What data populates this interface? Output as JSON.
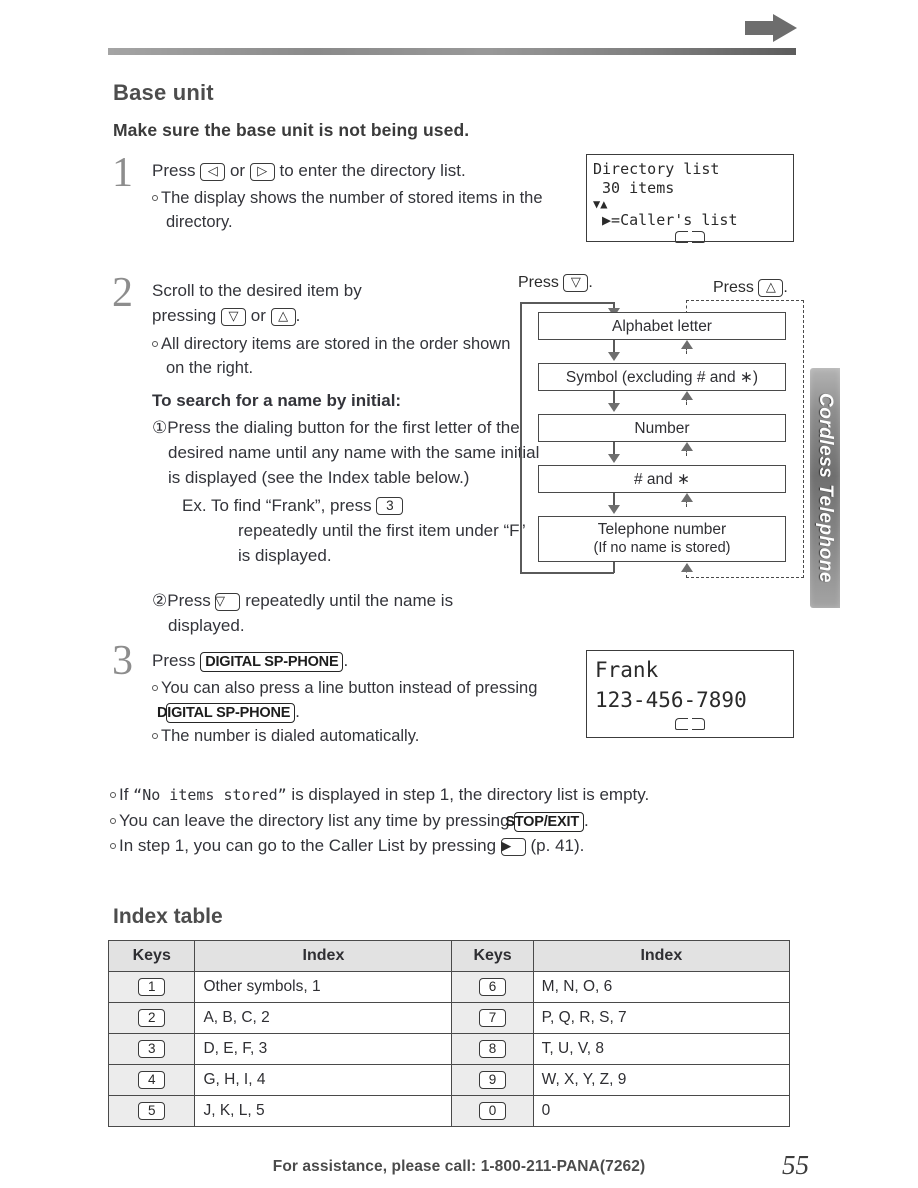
{
  "side_tab": {
    "label": "Cordless Telephone"
  },
  "headings": {
    "base_unit": "Base unit",
    "make_sure": "Make sure the base unit is not being used.",
    "index_table": "Index table"
  },
  "steps": {
    "one": {
      "number": "1",
      "line1_a": "Press",
      "key_left": "◁",
      "line1_b": "or",
      "key_right": "▷",
      "line1_c": "to enter the directory list.",
      "bullet1": "The display shows the number of stored items in the directory."
    },
    "two": {
      "number": "2",
      "line1_a": "Scroll to the desired item by",
      "line1_b": "pressing",
      "key_down": "▽",
      "line1_c": "or",
      "key_up": "△",
      "line1_d": ".",
      "bullet1": "All directory items are stored in the order shown on the right.",
      "search_heading": "To search for a name by initial:",
      "item1_marker": "①",
      "item1_text": "Press the dialing button for the first letter of the desired name until any name with the same initial is displayed (see the Index table below.)",
      "ex_label": "Ex.",
      "ex_text_a": "To find “Frank”, press",
      "ex_key": "3",
      "ex_text_b": "repeatedly until the first item under “F” is displayed.",
      "item2_marker": "②",
      "item2_text_a": "Press",
      "item2_key": "▽",
      "item2_text_b": "repeatedly until the name is displayed."
    },
    "three": {
      "number": "3",
      "line1_a": "Press",
      "button": "DIGITAL SP-PHONE",
      "line1_b": ".",
      "bullet1_a": "You can also press a line button instead of pressing",
      "bullet1_button": "DIGITAL SP-PHONE",
      "bullet1_b": ".",
      "bullet2": "The number is dialed automatically."
    }
  },
  "lcd1": {
    "line1": "Directory list",
    "line2": " 30 items",
    "line3": "▼▲",
    "line4": " ▶=Caller's list",
    "icon": "book-icon"
  },
  "lcd2": {
    "line1": "Frank",
    "line2": "123-456-7890",
    "icon": "book-icon"
  },
  "flow": {
    "press_down_a": "Press",
    "press_down_key": "▽",
    "press_down_b": ".",
    "press_up_a": "Press",
    "press_up_key": "△",
    "press_up_b": ".",
    "boxes": [
      {
        "label": "Alphabet letter"
      },
      {
        "label": "Symbol (excluding # and ∗)"
      },
      {
        "label": "Number"
      },
      {
        "label": "# and ∗"
      },
      {
        "label": "Telephone number",
        "sublabel": "(If no name is stored)"
      }
    ]
  },
  "notes": [
    {
      "pre": "If ",
      "mono": "“No items stored”",
      "post": " is displayed in step 1, the directory list is empty."
    },
    {
      "pre": "You can leave the directory list any time by pressing ",
      "button": "STOP/EXIT",
      "post": "."
    },
    {
      "pre": "In step 1, you can go to the Caller List by pressing ",
      "key": "▶",
      "post": " (p. 41)."
    }
  ],
  "index_table": {
    "headers": [
      "Keys",
      "Index",
      "Keys",
      "Index"
    ],
    "rows": [
      {
        "k1": "1",
        "i1": "Other symbols, 1",
        "k2": "6",
        "i2": "M, N, O, 6"
      },
      {
        "k1": "2",
        "i1": "A, B, C, 2",
        "k2": "7",
        "i2": "P, Q, R, S, 7"
      },
      {
        "k1": "3",
        "i1": "D, E, F, 3",
        "k2": "8",
        "i2": "T, U, V, 8"
      },
      {
        "k1": "4",
        "i1": "G, H, I, 4",
        "k2": "9",
        "i2": "W, X, Y, Z, 9"
      },
      {
        "k1": "5",
        "i1": "J, K, L, 5",
        "k2": "0",
        "i2": "0"
      }
    ]
  },
  "footer": {
    "assistance": "For assistance, please call: 1-800-211-PANA(7262)",
    "page_number": "55"
  }
}
